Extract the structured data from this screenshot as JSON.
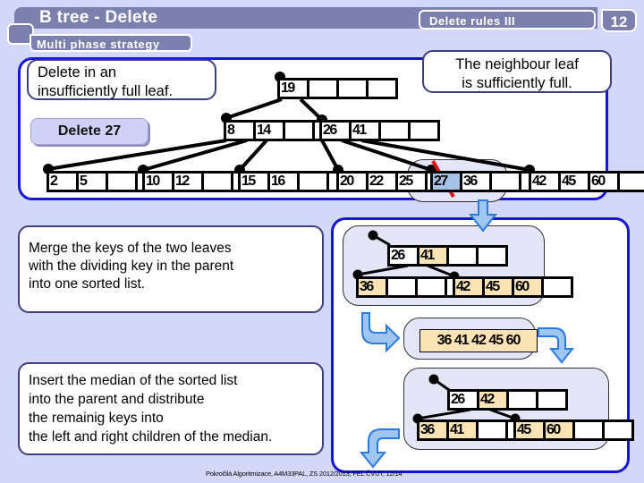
{
  "header": {
    "title": "B tree - Delete",
    "subtitle": "Multi phase strategy",
    "section": "Delete rules III",
    "slide_number": "12"
  },
  "callouts": {
    "insufficient": "Delete in an\ninsufficiently full leaf.",
    "neighbour": "The neighbour leaf\nis sufficiently full.",
    "merge": "Merge the keys of the two leaves\nwith the dividing key in the parent\ninto one sorted list.",
    "insert_median": "Insert the median of the sorted list\ninto the parent and distribute\nthe remainig keys into\nthe left and right children of the median."
  },
  "action_button": "Delete 27",
  "tree": {
    "root": [
      "19",
      "",
      "",
      ""
    ],
    "inner_left": [
      "8",
      "14",
      "",
      ""
    ],
    "inner_right": [
      "26",
      "41",
      "",
      ""
    ],
    "leaves": [
      [
        "2",
        "5",
        "",
        ""
      ],
      [
        "10",
        "12",
        "",
        ""
      ],
      [
        "15",
        "16",
        "",
        ""
      ],
      [
        "20",
        "22",
        "25",
        ""
      ],
      [
        "27",
        "36",
        "",
        ""
      ],
      [
        "42",
        "45",
        "60",
        ""
      ]
    ],
    "deleted_key": "27"
  },
  "merge_step": {
    "parent": [
      "26",
      "41",
      "",
      ""
    ],
    "left": [
      "36",
      "",
      "",
      ""
    ],
    "right": [
      "42",
      "45",
      "60",
      ""
    ]
  },
  "sorted_list": "36 41 42 45 60",
  "result_step": {
    "parent": [
      "26",
      "42",
      "",
      ""
    ],
    "left": [
      "36",
      "41",
      "",
      ""
    ],
    "right": [
      "45",
      "60",
      "",
      ""
    ]
  },
  "footer": "Pokročilá Algoritmizace, A4M33PAL, ZS 2012/2013, FEL ČVUT,  12/14",
  "colors": {
    "header_bg": "#7b80ac",
    "page_bg": "#d4d8f8",
    "panel_border": "#1515d8",
    "highlight_key": "#fce3b6",
    "deleted_key": "#a6c2e6",
    "strike": "#e01010",
    "arrow": "#2a7ae0"
  }
}
